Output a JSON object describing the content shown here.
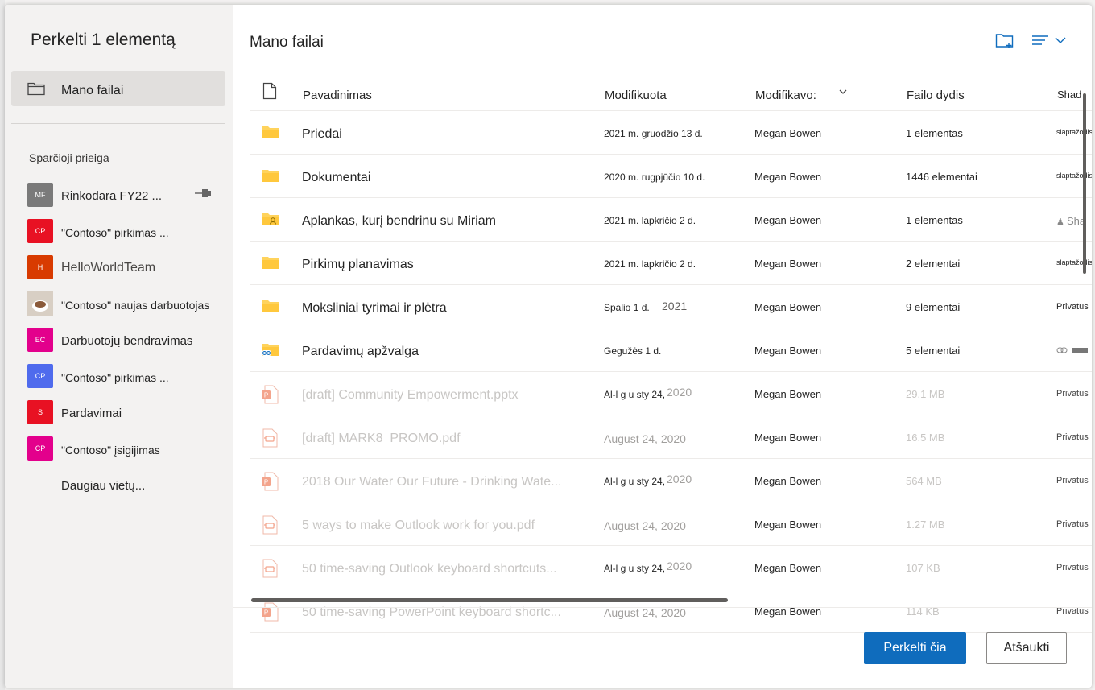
{
  "dialog": {
    "title": "Perkelti 1 elementą",
    "nav_my_files": "Mano failai",
    "quick_access_title": "Sparčioji prieiga",
    "quick_access": [
      {
        "badge": "MF",
        "name": "Rinkodara FY22 ...",
        "color": "#7a7a7a",
        "pinned": true
      },
      {
        "badge": "CP",
        "name": "\"Contoso\" pirkimas ...",
        "color": "#e81123"
      },
      {
        "badge": "H",
        "name": "HelloWorldTeam",
        "color": "#d83b01"
      },
      {
        "badge": "",
        "name": "\"Contoso\" naujas darbuotojas",
        "color": "#c8b8a8"
      },
      {
        "badge": "EC",
        "name": "Darbuotojų bendravimas",
        "color": "#e3008c"
      },
      {
        "badge": "CP",
        "name": "\"Contoso\" pirkimas ...",
        "color": "#4f6bed"
      },
      {
        "badge": "S",
        "name": "Pardavimai",
        "color": "#e81123"
      },
      {
        "badge": "CP",
        "name": "\"Contoso\" įsigijimas",
        "color": "#e3008c"
      }
    ],
    "more_places": "Daugiau vietų..."
  },
  "content": {
    "breadcrumb": "Mano failai",
    "columns": {
      "name": "Pavadinimas",
      "modified": "Modifikuota",
      "modified_by": "Modifikavo:",
      "size": "Failo dydis",
      "sharing": "Shad"
    },
    "rows": [
      {
        "type": "folder",
        "name": "Priedai",
        "modified": "2021 m. gruodžio 13 d.",
        "by": "Megan Bowen",
        "size": "1 elementas",
        "sharing": "slaptažodis"
      },
      {
        "type": "folder",
        "name": "Dokumentai",
        "modified": "2020 m. rugpjūčio 10 d.",
        "by": "Megan Bowen",
        "size": "1446 elementai",
        "sharing": "slaptažodis"
      },
      {
        "type": "folder-shared",
        "name": "Aplankas, kurį bendrinu su Miriam",
        "modified": "2021 m. lapkričio 2 d.",
        "by": "Megan Bowen",
        "size": "1 elementas",
        "sharing": "Sha"
      },
      {
        "type": "folder",
        "name": "Pirkimų planavimas",
        "modified": "2021 m. lapkričio 2 d.",
        "by": "Megan Bowen",
        "size": "2 elementai",
        "sharing": "slaptažodis"
      },
      {
        "type": "folder",
        "name": "Moksliniai tyrimai ir plėtra",
        "modified": "Spalio 1 d.",
        "modified_extra": "2021",
        "by": "Megan Bowen",
        "size": "9 elementai",
        "sharing": "Privatus"
      },
      {
        "type": "folder-link",
        "name": "Pardavimų apžvalga",
        "modified": "Gegužės 1 d.",
        "by": "Megan Bowen",
        "size": "5 elementai",
        "sharing": "link"
      },
      {
        "type": "pptx",
        "name": "[draft] Community Empowerment.pptx",
        "modified": "Al-l g u sty 24,",
        "modified_extra": "2020",
        "by": "Megan Bowen",
        "size": "29.1 MB",
        "sharing": "Privatus"
      },
      {
        "type": "pdf",
        "name": "[draft] MARK8_PROMO.pdf",
        "modified": "August 24, 2020",
        "by": "Megan Bowen",
        "size": "16.5 MB",
        "sharing": "Privatus"
      },
      {
        "type": "pptx",
        "name": "2018 Our Water Our Future - Drinking Wate...",
        "modified": "Al-l g u sty 24,",
        "modified_extra": "2020",
        "by": "Megan Bowen",
        "size": "564 MB",
        "sharing": "Privatus"
      },
      {
        "type": "pdf",
        "name": "5 ways to make Outlook work for you.pdf",
        "modified": "August 24, 2020",
        "by": "Megan Bowen",
        "size": "1.27 MB",
        "sharing": "Privatus"
      },
      {
        "type": "pdf",
        "name": "50 time-saving Outlook keyboard shortcuts...",
        "modified": "Al-l g u sty 24,",
        "modified_extra": "2020",
        "by": "Megan Bowen",
        "size": "107 KB",
        "sharing": "Privatus"
      },
      {
        "type": "pptx",
        "name": "50 time-saving PowerPoint keyboard shortc...",
        "modified": "August 24, 2020",
        "by": "Megan Bowen",
        "size": "114 KB",
        "sharing": "Privatus"
      }
    ]
  },
  "footer": {
    "move_here": "Perkelti čia",
    "cancel": "Atšaukti"
  },
  "colors": {
    "accent": "#0f6cbd",
    "folder": "#ffd35c",
    "pptx": "#e66f4c",
    "pdf": "#e66f4c"
  }
}
